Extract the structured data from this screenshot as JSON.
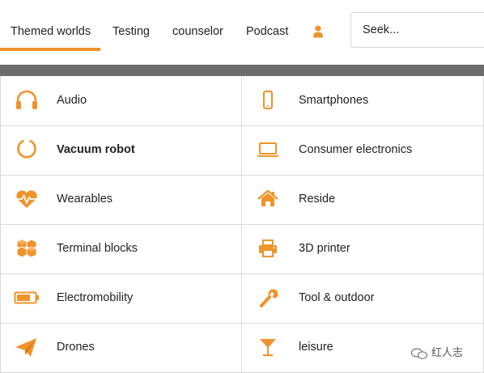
{
  "nav": {
    "items": [
      {
        "label": "Themed worlds",
        "active": true
      },
      {
        "label": "Testing"
      },
      {
        "label": "counselor"
      },
      {
        "label": "Podcast"
      }
    ],
    "user_icon": "user-icon",
    "search": {
      "placeholder": "Seek..."
    }
  },
  "accent_color": "#f0932b",
  "menu": {
    "left": [
      {
        "label": "Audio",
        "icon": "headphones-icon"
      },
      {
        "label": "Vacuum robot",
        "icon": "ring-icon",
        "bold": true
      },
      {
        "label": "Wearables",
        "icon": "heartbeat-icon"
      },
      {
        "label": "Terminal blocks",
        "icon": "cubes-icon"
      },
      {
        "label": "Electromobility",
        "icon": "battery-icon"
      },
      {
        "label": "Drones",
        "icon": "paper-plane-icon"
      }
    ],
    "right": [
      {
        "label": "Smartphones",
        "icon": "smartphone-icon"
      },
      {
        "label": "Consumer electronics",
        "icon": "laptop-icon"
      },
      {
        "label": "Reside",
        "icon": "home-icon"
      },
      {
        "label": "3D printer",
        "icon": "printer-icon"
      },
      {
        "label": "Tool & outdoor",
        "icon": "wrench-icon"
      },
      {
        "label": "leisure",
        "icon": "cocktail-icon"
      }
    ]
  },
  "watermark": {
    "text": "红人志",
    "icon": "wechat-icon"
  }
}
